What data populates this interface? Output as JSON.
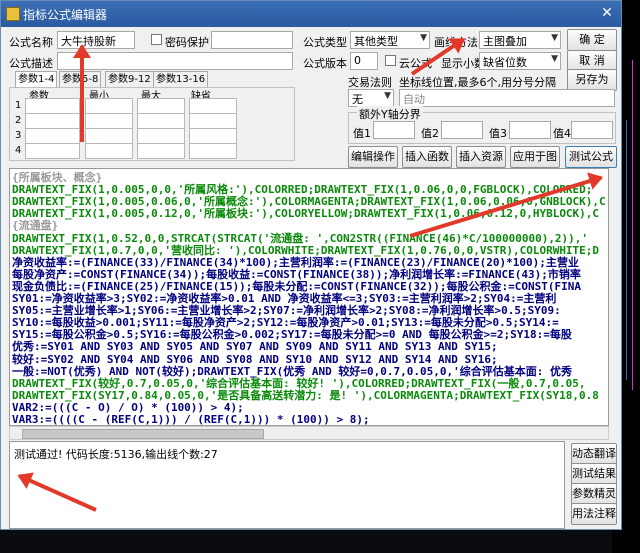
{
  "window": {
    "title": "指标公式编辑器"
  },
  "form": {
    "name_label": "公式名称",
    "name_value": "大牛持股新",
    "password_label": "密码保护",
    "desc_label": "公式描述",
    "type_label": "公式类型",
    "type_value": "其他类型",
    "draw_label": "画线方法",
    "draw_value": "主图叠加",
    "version_label": "公式版本",
    "version_value": "0",
    "cloud_label": "云公式",
    "show_decimal_label": "显示小数",
    "decimal_value": "缺省位数",
    "trade_rule_label": "交易法则",
    "coord_label": "坐标线位置,最多6个,用分号分隔",
    "rule_value": "无",
    "coord_placeholder": "自动",
    "extra_axis_label": "额外Y轴分界",
    "value1_label": "值1",
    "value2_label": "值2",
    "value3_label": "值3",
    "value4_label": "值4"
  },
  "buttons": {
    "ok": "确  定",
    "cancel": "取  消",
    "save_as": "另存为",
    "edit_op": "编辑操作",
    "insert_func": "插入函数",
    "insert_res": "插入资源",
    "apply_chart": "应用于图",
    "test_formula": "测试公式",
    "dyn_translate": "动态翻译",
    "test_result": "测试结果",
    "param_wizard": "参数精灵",
    "usage_notes": "用法注释"
  },
  "param_tabs": [
    "参数1-4",
    "参数5-8",
    "参数9-12",
    "参数13-16"
  ],
  "param_headers": [
    "参数",
    "最小",
    "最大",
    "缺省"
  ],
  "param_rows": [
    "1",
    "2",
    "3",
    "4"
  ],
  "code_lines": [
    {
      "text": "{所属板块、概念}",
      "color": "#9a9a9a"
    },
    {
      "text": "DRAWTEXT_FIX(1,0.005,0,0,'所属风格:'),COLORRED;DRAWTEXT_FIX(1,0.06,0,0,FGBLOCK),COLORRED;",
      "color": "#0a8a0a"
    },
    {
      "text": "DRAWTEXT_FIX(1,0.005,0.06,0,'所属概念:'),COLORMAGENTA;DRAWTEXT_FIX(1,0.06,0.06,0,GNBLOCK),C",
      "color": "#0a8a0a"
    },
    {
      "text": "DRAWTEXT_FIX(1,0.005,0.12,0,'所属板块:'),COLORYELLOW;DRAWTEXT_FIX(1,0.06,0.12,0,HYBLOCK),C",
      "color": "#0a8a0a"
    },
    {
      "text": "{流通盘}",
      "color": "#9a9a9a"
    },
    {
      "text": "DRAWTEXT_FIX(1,0.52,0,0,STRCAT(STRCAT('流通盘: ',CON2STR((FINANCE(46)*C/100000000),2)),'",
      "color": "#0a8a0a"
    },
    {
      "text": "DRAWTEXT_FIX(1,0.7,0,0,'营收同比: '),COLORWHITE;DRAWTEXT_FIX(1,0.76,0,0,VSTR),COLORWHITE;D",
      "color": "#0a8a0a"
    },
    {
      "text": "净资收益率:=(FINANCE(33)/FINANCE(34)*100);主营利润率:=(FINANCE(23)/FINANCE(20)*100);主营业",
      "color": "#000080"
    },
    {
      "text": "每股净资产:=CONST(FINANCE(34));每股收益:=CONST(FINANCE(38));净利润增长率:=FINANCE(43);市销率",
      "color": "#000080"
    },
    {
      "text": "现金负债比:=(FINANCE(25)/FINANCE(15));每股未分配:=CONST(FINANCE(32));每股公积金:=CONST(FINA",
      "color": "#000080"
    },
    {
      "text": "SY01:=净资收益率>3;SY02:=净资收益率>0.01 AND 净资收益率<=3;SY03:=主营利润率>2;SY04:=主营利",
      "color": "#000080"
    },
    {
      "text": "SY05:=主营业增长率>1;SY06:=主营业增长率>2;SY07:=净利润增长率>2;SY08:=净利润增长率>0.5;SY09:",
      "color": "#000080"
    },
    {
      "text": "SY10:=每股收益>0.001;SY11:=每股净资产>2;SY12:=每股净资产>0.01;SY13:=每股未分配>0.5;SY14:=",
      "color": "#000080"
    },
    {
      "text": "SY15:=每股公积金>0.5;SY16:=每股公积金>0.002;SY17:=每股未分配>=0 AND 每股公积金>=2;SY18:=每股",
      "color": "#000080"
    },
    {
      "text": "优秀:=SY01 AND SY03 AND SY05 AND SY07 AND SY09 AND SY11 AND SY13 AND SY15;",
      "color": "#000080"
    },
    {
      "text": "较好:=SY02 AND SY04 AND SY06 AND SY08 AND SY10 AND SY12 AND SY14 AND SY16;",
      "color": "#000080"
    },
    {
      "text": "一般:=NOT(优秀) AND NOT(较好);DRAWTEXT_FIX(优秀 AND 较好=0,0.7,0.05,0,'综合评估基本面: 优秀",
      "color": "#000080"
    },
    {
      "text": "DRAWTEXT_FIX(较好,0.7,0.05,0,'综合评估基本面: 较好! '),COLORRED;DRAWTEXT_FIX(一般,0.7,0.05,",
      "color": "#0a8a0a"
    },
    {
      "text": "DRAWTEXT_FIX(SY17,0.84,0.05,0,'是否具备高送转潜力: 是! '),COLORMAGENTA;DRAWTEXT_FIX(SY18,0.8",
      "color": "#0a8a0a"
    },
    {
      "text": "VAR2:=(((C - O) / O) * (100)) > 4);",
      "color": "#000080"
    },
    {
      "text": "VAR3:=((((C - (REF(C,1))) / (REF(C,1))) * (100)) > 8);",
      "color": "#000080"
    }
  ],
  "status_text": "测试通过! 代码长度:5136,输出线个数:27"
}
